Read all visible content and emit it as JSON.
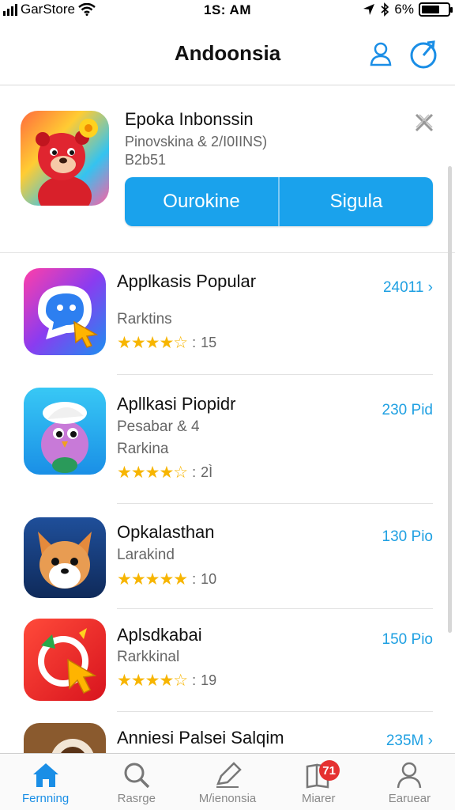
{
  "status_bar": {
    "carrier": "GarStore",
    "time": "1S: AM",
    "battery": "6%"
  },
  "nav": {
    "title": "Andoonsia"
  },
  "promo": {
    "title": "Epoka Inbonssin",
    "subtitle": "Pinovskina & 2/I0IINS)",
    "subtitle2": "B2b51",
    "left_button": "Ourokine",
    "right_button": "Sigula"
  },
  "apps": [
    {
      "title": "Applkasis Popular",
      "line1": "",
      "line2": "Rarktins",
      "rating_count": "15",
      "stars": "★★★★☆",
      "price": "24011 ›",
      "icon": "chat-bubble-icon"
    },
    {
      "title": "Apllkasi Piopidr",
      "line1": "Pesabar & 4",
      "line2": "Rarkina",
      "rating_count": "2Ì",
      "stars": "★★★★☆",
      "price": "230 Pid",
      "icon": "bird-icon"
    },
    {
      "title": "Opkalasthan",
      "line1": "",
      "line2": "Larakind",
      "rating_count": "10",
      "stars": "★★★★★",
      "price": "130 Pio",
      "icon": "fox-icon"
    },
    {
      "title": "Aplsdkabai",
      "line1": "",
      "line2": "Rarkkinal",
      "rating_count": "19",
      "stars": "★★★★☆",
      "price": "150 Pio",
      "icon": "cursor-circle-icon"
    },
    {
      "title": "Anniesi Palsei Salqim",
      "line1": "",
      "line2": "",
      "rating_count": "",
      "stars": "",
      "price": "235M ›",
      "icon": "coffee-icon"
    }
  ],
  "tabs": [
    {
      "label": "Fernning",
      "icon": "home-icon",
      "active": true
    },
    {
      "label": "Rasrge",
      "icon": "search-icon",
      "active": false
    },
    {
      "label": "M/ienonsia",
      "icon": "edit-icon",
      "active": false
    },
    {
      "label": "Miarer",
      "icon": "book-icon",
      "active": false,
      "badge": "71"
    },
    {
      "label": "Earuear",
      "icon": "person-icon",
      "active": false
    }
  ],
  "colors": {
    "accent": "#1aa2ec",
    "price": "#1fa0e2",
    "stars": "#f7b500",
    "badge": "#e53030"
  }
}
